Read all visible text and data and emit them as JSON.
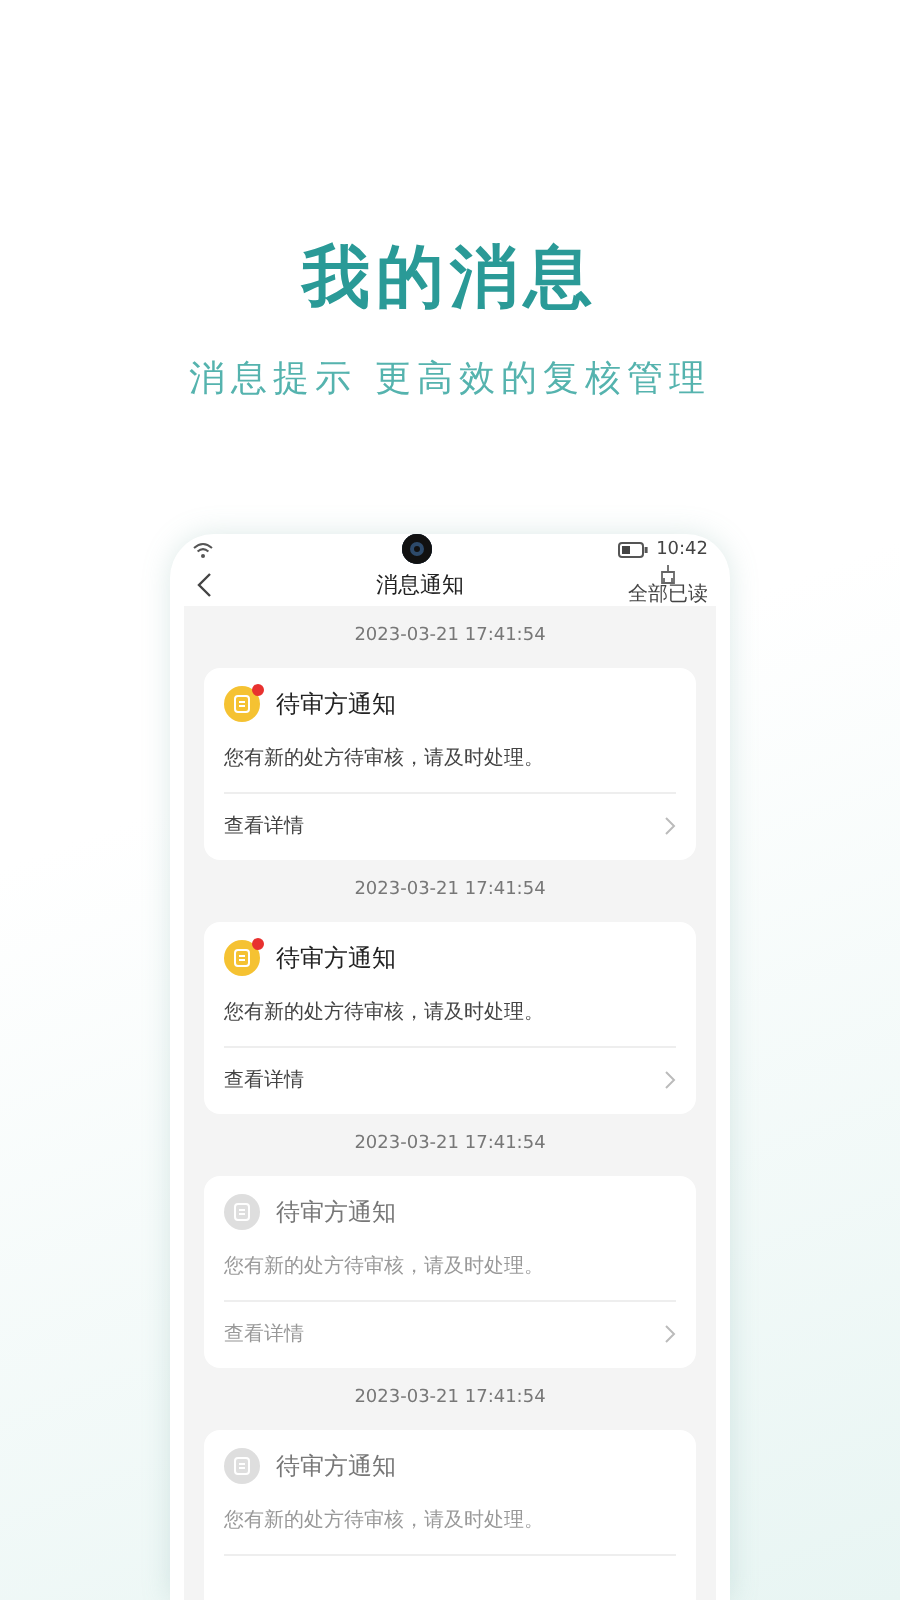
{
  "headline": "我的消息",
  "tagline": "消息提示 更高效的复核管理",
  "status_bar": {
    "time": "10:42"
  },
  "nav": {
    "title": "消息通知",
    "action": "全部已读"
  },
  "messages": [
    {
      "time": "2023-03-21 17:41:54",
      "title": "待审方通知",
      "body": "您有新的处方待审核，请及时处理。",
      "link": "查看详情",
      "unread": true
    },
    {
      "time": "2023-03-21 17:41:54",
      "title": "待审方通知",
      "body": "您有新的处方待审核，请及时处理。",
      "link": "查看详情",
      "unread": true
    },
    {
      "time": "2023-03-21 17:41:54",
      "title": "待审方通知",
      "body": "您有新的处方待审核，请及时处理。",
      "link": "查看详情",
      "unread": false
    },
    {
      "time": "2023-03-21 17:41:54",
      "title": "待审方通知",
      "body": "您有新的处方待审核，请及时处理。",
      "unread": false
    }
  ]
}
